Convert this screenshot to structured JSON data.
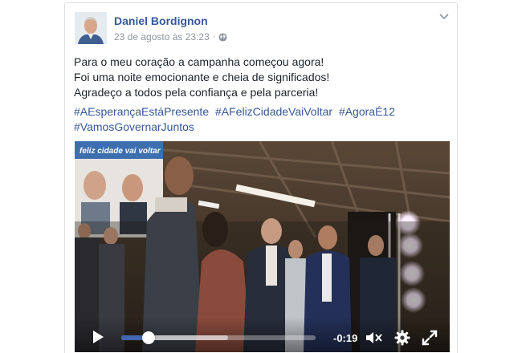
{
  "post": {
    "author": "Daniel Bordignon",
    "timestamp": "23 de agosto às 23:23",
    "separator": "·",
    "privacy_icon": "globe-icon",
    "options_icon": "chevron-down-icon",
    "lines": [
      "Para o meu coração a campanha começou agora!",
      "Foi uma noite emocionante e cheia de significados!",
      "Agradeço a todos pela confiança e pela parceria!"
    ],
    "hashtags": [
      "#AEsperançaEstáPresente",
      "#AFelizCidadeVaiVoltar",
      "#AgoraÉ12",
      "#VamosGovernarJuntos"
    ]
  },
  "video": {
    "banner_text": "feliz cidade vai voltar",
    "time_remaining": "-0:19",
    "progress": 0.14,
    "buffered": 0.55,
    "accent_color": "#4267b2",
    "icons": [
      "play-icon",
      "mute-icon",
      "settings-icon",
      "fullscreen-icon"
    ]
  }
}
